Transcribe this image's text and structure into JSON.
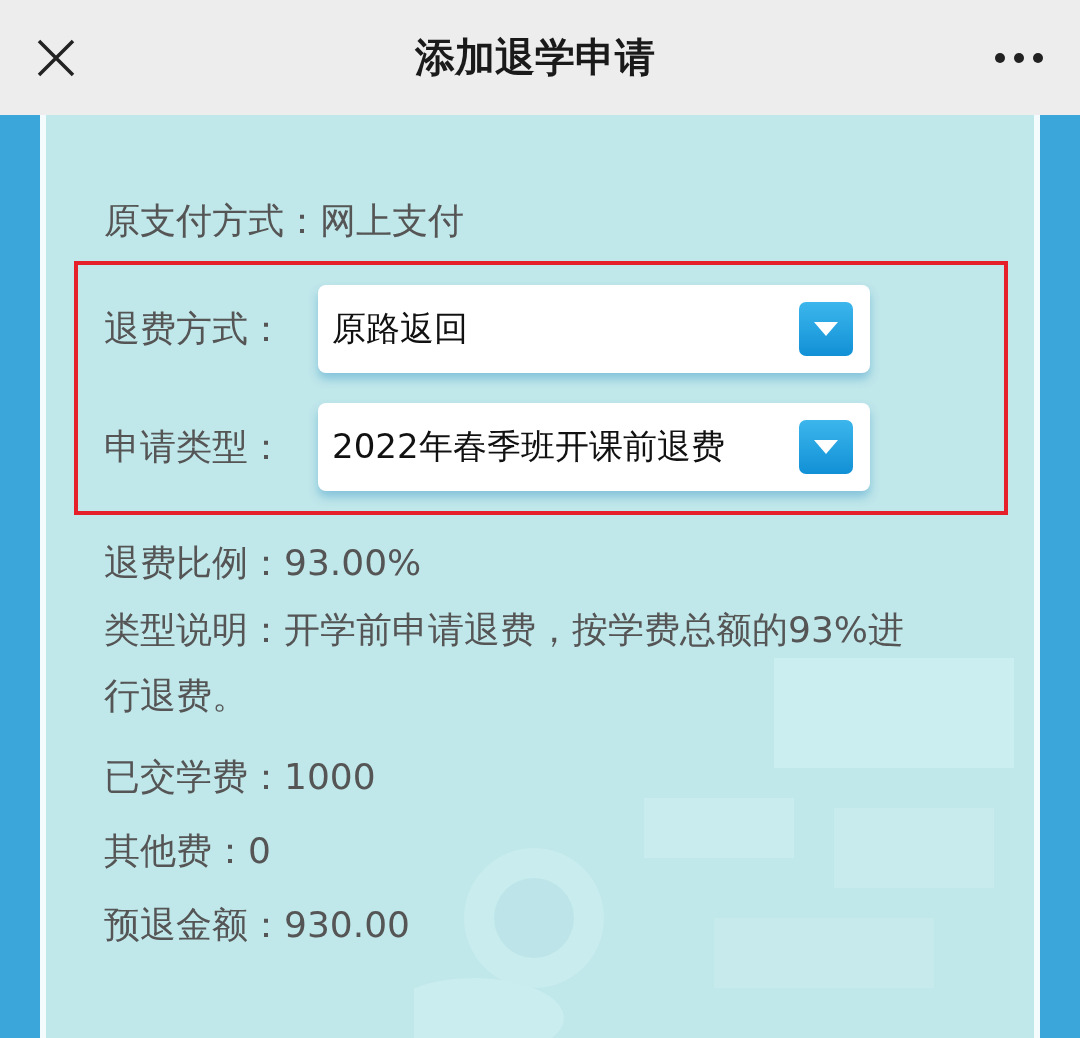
{
  "header": {
    "title": "添加退学申请"
  },
  "rows": [
    {
      "kind": "text",
      "label": "原支付方式：",
      "value": "网上支付"
    },
    {
      "kind": "select",
      "label": "退费方式：",
      "value": "原路返回"
    },
    {
      "kind": "select",
      "label": "申请类型：",
      "value": "2022年春季班开课前退费"
    },
    {
      "kind": "text",
      "label": "退费比例：",
      "value": "93.00%"
    },
    {
      "kind": "para",
      "text": "类型说明：开学前申请退费，按学费总额的93%进行退费。"
    },
    {
      "kind": "text",
      "label": "已交学费：",
      "value": "1000"
    },
    {
      "kind": "text",
      "label": "其他费：",
      "value": "0"
    },
    {
      "kind": "text",
      "label": "预退金额：",
      "value": "930.00"
    }
  ]
}
